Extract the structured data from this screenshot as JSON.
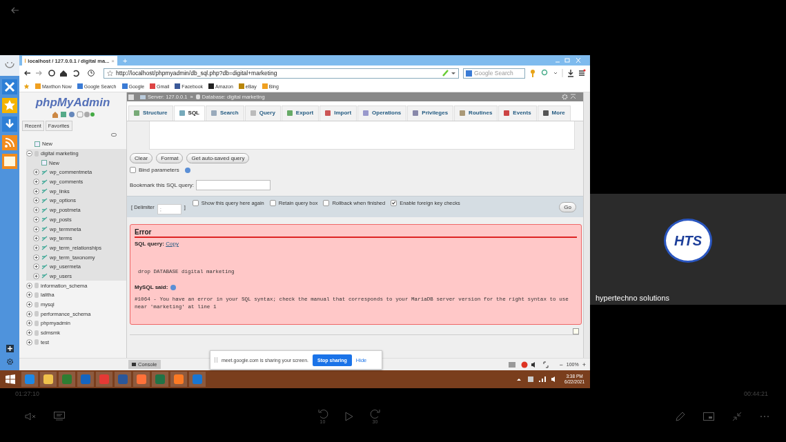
{
  "browser": {
    "tab_title": "localhost / 127.0.0.1 / digital ma...",
    "tab_close": "×",
    "new_tab": "+",
    "url": "http://localhost/phpmyadmin/db_sql.php?db=digital+marketing",
    "search_placeholder": "Google Search",
    "bookmarks": [
      "Maxthon Now",
      "Google Search",
      "Google",
      "Gmail",
      "Facebook",
      "Amazon",
      "eBay",
      "Bing"
    ]
  },
  "nav": {
    "logo": "phpMyAdmin",
    "tabs": [
      {
        "label": "Recent",
        "selected": false
      },
      {
        "label": "Favorites",
        "selected": false
      }
    ],
    "tree": [
      {
        "kind": "new",
        "label": "New"
      },
      {
        "kind": "database",
        "label": "digital marketing",
        "expanded": true,
        "children": [
          {
            "kind": "new",
            "label": "New"
          },
          {
            "kind": "table",
            "label": "wp_commentmeta",
            "expanded": false
          },
          {
            "kind": "table",
            "label": "wp_comments",
            "expanded": false
          },
          {
            "kind": "table",
            "label": "wp_links",
            "expanded": false
          },
          {
            "kind": "table",
            "label": "wp_options",
            "expanded": false
          },
          {
            "kind": "table",
            "label": "wp_postmeta",
            "expanded": false
          },
          {
            "kind": "table",
            "label": "wp_posts",
            "expanded": false
          },
          {
            "kind": "table",
            "label": "wp_termmeta",
            "expanded": false
          },
          {
            "kind": "table",
            "label": "wp_terms",
            "expanded": false
          },
          {
            "kind": "table",
            "label": "wp_term_relationships",
            "expanded": false
          },
          {
            "kind": "table",
            "label": "wp_term_taxonomy",
            "expanded": false
          },
          {
            "kind": "table",
            "label": "wp_usermeta",
            "expanded": false
          },
          {
            "kind": "table",
            "label": "wp_users",
            "expanded": false
          }
        ]
      },
      {
        "kind": "database",
        "label": "information_schema",
        "expanded": false
      },
      {
        "kind": "database",
        "label": "lalitha",
        "expanded": false
      },
      {
        "kind": "database",
        "label": "mysql",
        "expanded": false
      },
      {
        "kind": "database",
        "label": "performance_schema",
        "expanded": false
      },
      {
        "kind": "database",
        "label": "phpmyadmin",
        "expanded": false
      },
      {
        "kind": "database",
        "label": "sdmsmk",
        "expanded": false
      },
      {
        "kind": "database",
        "label": "test",
        "expanded": false
      }
    ]
  },
  "breadcrumb": {
    "server": "Server: 127.0.0.1",
    "separator": "»",
    "database": "Database: digital marketing"
  },
  "tabs": [
    {
      "label": "Structure",
      "selected": false
    },
    {
      "label": "SQL",
      "selected": true
    },
    {
      "label": "Search",
      "selected": false
    },
    {
      "label": "Query",
      "selected": false
    },
    {
      "label": "Export",
      "selected": false
    },
    {
      "label": "Import",
      "selected": false
    },
    {
      "label": "Operations",
      "selected": false
    },
    {
      "label": "Privileges",
      "selected": false
    },
    {
      "label": "Routines",
      "selected": false
    },
    {
      "label": "Events",
      "selected": false
    },
    {
      "label": "More",
      "selected": false
    }
  ],
  "query_buttons": [
    "Clear",
    "Format",
    "Get auto-saved query"
  ],
  "bind_parameters": {
    "label": "Bind parameters",
    "checked": false
  },
  "bookmark_label": "Bookmark this SQL query:",
  "delimiter": {
    "open": "[ Delimiter",
    "value": ";",
    "close": "]"
  },
  "options": [
    {
      "label": "Show this query here again",
      "checked": false
    },
    {
      "label": "Retain query box",
      "checked": false
    },
    {
      "label": "Rollback when finished",
      "checked": false
    },
    {
      "label": "Enable foreign key checks",
      "checked": true
    }
  ],
  "go": "Go",
  "error": {
    "title": "Error",
    "sql_query_label": "SQL query:",
    "copy_link": "Copy",
    "query": "drop DATABASE digital marketing",
    "said_label": "MySQL said:",
    "message": "#1064 - You have an error in your SQL syntax; check the manual that corresponds to your MariaDB server version for the right syntax to use near 'marketing' at line 1"
  },
  "console": "Console",
  "sharing": {
    "message": "meet.google.com is sharing your screen.",
    "stop": "Stop sharing",
    "hide": "Hide"
  },
  "status": {
    "zoom_minus": "−",
    "zoom": "100%",
    "zoom_plus": "+"
  },
  "taskbar": {
    "time": "3:38 PM",
    "date": "6/22/2021"
  },
  "participant": {
    "logo": "HTS",
    "name": "hypertechno solutions"
  },
  "player": {
    "elapsed": "01:27:10",
    "remaining": "00:44:21",
    "rewind": "10",
    "forward": "30"
  }
}
